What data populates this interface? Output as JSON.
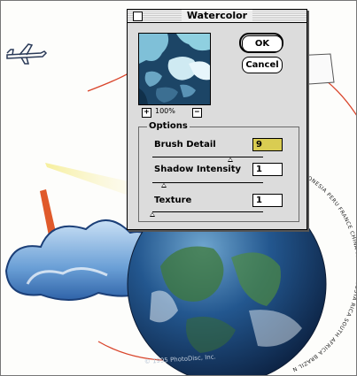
{
  "dialog": {
    "title": "Watercolor",
    "ok_label": "OK",
    "cancel_label": "Cancel",
    "zoom_out_symbol": "+",
    "zoom_in_symbol": "−",
    "zoom_level": "100%",
    "options_label": "Options",
    "options": [
      {
        "label": "Brush Detail",
        "value": "9",
        "slider_fraction": 0.7
      },
      {
        "label": "Shadow Intensity",
        "value": "1",
        "slider_fraction": 0.1
      },
      {
        "label": "Texture",
        "value": "1",
        "slider_fraction": 0.0
      }
    ]
  },
  "artwork": {
    "ring_text": "INDONESIA PERU FRANCE CHINA FINLAND COSTA RICA SOUTH AFRICA BRAZIL NEW ZEALAND",
    "copyright_text": "© 1995 PhotoDisc, Inc.",
    "colors": {
      "sky": "#fdfdfb",
      "cloud": "#6a9fd6",
      "ocean": "#1f4e86",
      "land": "#3f7a3a",
      "orbit_line": "#d9452b",
      "beam_red": "#e05a2b",
      "beam_yellow": "#f3e79a",
      "input_highlight": "#d9cc52"
    }
  }
}
